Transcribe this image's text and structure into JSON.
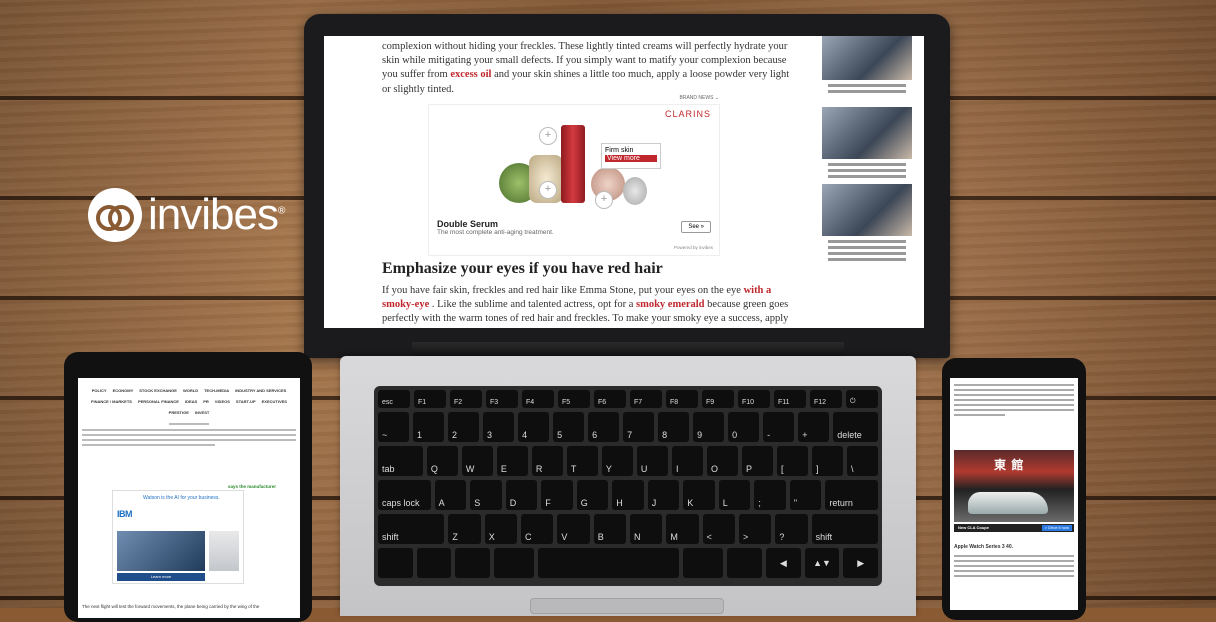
{
  "brand": {
    "logo_text": "invibes"
  },
  "laptop": {
    "article": {
      "intro": "complexion without hiding your freckles. These lightly tinted creams will perfectly hydrate your skin while mitigating your small defects. If you simply want to matify your complexion because you suffer from",
      "intro_red": "excess oil",
      "intro_end": "and your skin shines a little too much, apply a loose powder very light or slightly tinted.",
      "heading": "Emphasize your eyes if you have red hair",
      "body_1": "If you have fair skin, freckles and red hair like Emma Stone, put your eyes on the eye",
      "body_red_1": "with a smoky-eye",
      "body_2": ". Like the sublime and talented actress, opt for a",
      "body_red_2": "smoky emerald",
      "body_3": "because green goes perfectly with the warm tones of red hair and freckles. To make your smoky eye a success, apply dark green eyeshadow over the entire eyelid and carefully blend the contours with a stubby"
    },
    "ad": {
      "brand_news": "BRAND NEWS ⌄",
      "brand": "CLARINS",
      "tooltip_title": "Firm skin",
      "tooltip_cta": "View more",
      "title": "Double Serum",
      "subtitle": "The most complete anti-aging treatment.",
      "see_button": "See »",
      "powered": "Powered by invibes"
    },
    "keyboard": {
      "fn_row": [
        "esc",
        "F1",
        "F2",
        "F3",
        "F4",
        "F5",
        "F6",
        "F7",
        "F8",
        "F9",
        "F10",
        "F11",
        "F12",
        "⏻"
      ],
      "row1": [
        "~",
        "1",
        "2",
        "3",
        "4",
        "5",
        "6",
        "7",
        "8",
        "9",
        "0",
        "-",
        "+",
        "delete"
      ],
      "row2": [
        "tab",
        "Q",
        "W",
        "E",
        "R",
        "T",
        "Y",
        "U",
        "I",
        "O",
        "P",
        "[",
        "]",
        "\\"
      ],
      "row3": [
        "caps lock",
        "A",
        "S",
        "D",
        "F",
        "G",
        "H",
        "J",
        "K",
        "L",
        ";",
        "\"",
        "return"
      ],
      "row4": [
        "shift",
        "Z",
        "X",
        "C",
        "V",
        "B",
        "N",
        "M",
        "<",
        ">",
        "?",
        "shift"
      ]
    }
  },
  "tablet": {
    "nav": [
      "POLICY",
      "ECONOMY",
      "STOCK EXCHANGE",
      "WORLD",
      "TECH-MEDIA",
      "INDUSTRY AND SERVICES",
      "FINANCE / MARKETS",
      "PERSONAL FINANCE",
      "IDEAS",
      "PR",
      "VIDEOS",
      "START-UP",
      "EXECUTIVES",
      "PRESTIGE",
      "INVEST"
    ],
    "link": "says the manufacturer",
    "ad_brand": "IBM",
    "ad_message": "Watson is the AI for your business.",
    "ad_cta": "Learn more",
    "footer": "The next flight will test the forward movements, the plane being carried by the wing of the"
  },
  "phone": {
    "sign": "東 館",
    "bar_label": "New CLA Coupe",
    "bar_cta": "> Drive it now",
    "title": "Apple Watch Series 3 40."
  }
}
